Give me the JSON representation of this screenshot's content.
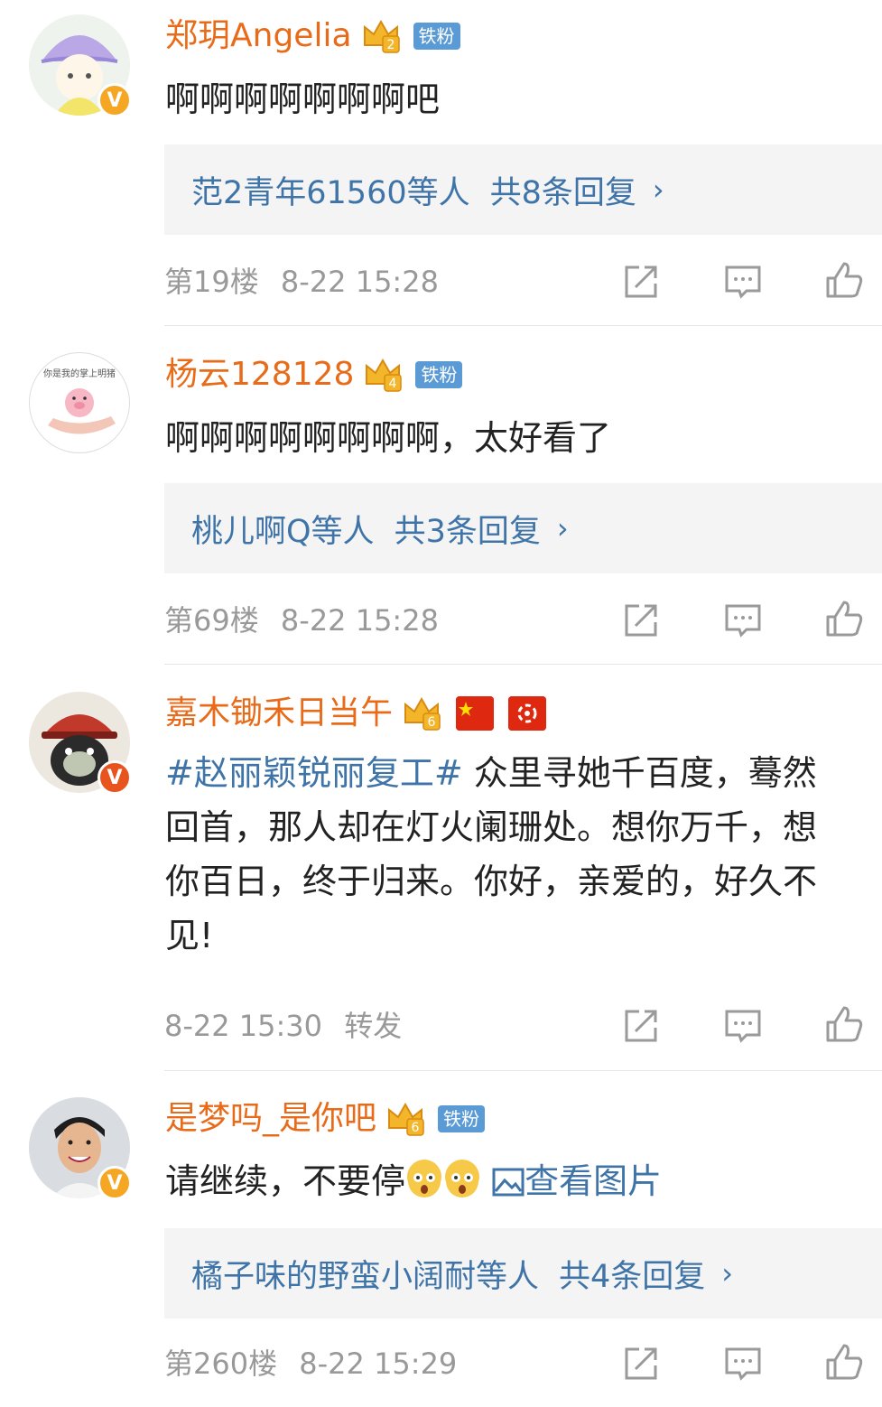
{
  "colors": {
    "username": "#e86b1a",
    "link": "#3f74a8",
    "meta": "#999999",
    "reply_bg": "#f4f4f4",
    "badge_blue": "#5b9bd5"
  },
  "comments": [
    {
      "username": "郑玥Angelia",
      "crown_level": "2",
      "fan_badge": "铁粉",
      "verified": "V",
      "text": "啊啊啊啊啊啊啊吧",
      "reply_preview": "范2青年61560等人",
      "reply_total": "共8条回复",
      "floor": "第19楼",
      "time": "8-22 15:28"
    },
    {
      "username": "杨云128128",
      "crown_level": "4",
      "fan_badge": "铁粉",
      "avatar_caption": "你是我的掌上明猪",
      "text": "啊啊啊啊啊啊啊啊，太好看了",
      "reply_preview": "桃儿啊Q等人",
      "reply_total": "共3条回复",
      "floor": "第69楼",
      "time": "8-22 15:28"
    },
    {
      "username": "嘉木锄禾日当午",
      "crown_level": "6",
      "verified": "V",
      "topic": "#赵丽颖锐丽复工#",
      "text_lines": [
        " 众里寻她千百度，蓦然",
        "回首，那人却在灯火阑珊处。想你万千，想",
        "你百日，终于归来。你好，亲爱的，好久不",
        "见!"
      ],
      "time": "8-22 15:30",
      "extra": "转发"
    },
    {
      "username": "是梦吗_是你吧",
      "crown_level": "6",
      "fan_badge": "铁粉",
      "verified": "V",
      "text": "请继续，不要停",
      "image_link": "查看图片",
      "reply_preview": "橘子味的野蛮小阔耐等人",
      "reply_total": "共4条回复",
      "floor": "第260楼",
      "time": "8-22 15:29"
    }
  ],
  "icons": {
    "share": "share-icon",
    "comment": "comment-icon",
    "like": "like-icon",
    "chevron": "›"
  }
}
